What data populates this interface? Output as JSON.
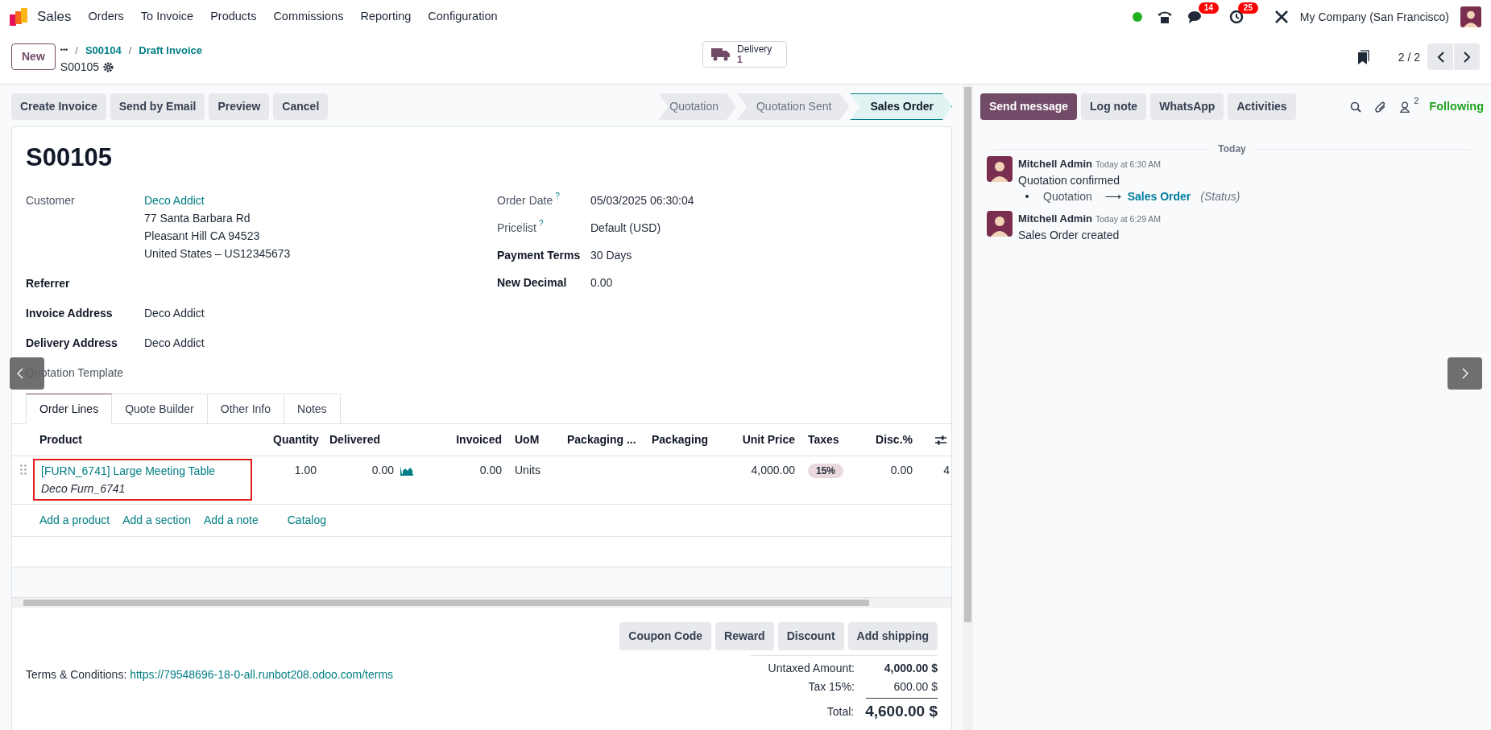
{
  "navbar": {
    "app": "Sales",
    "menu": [
      "Orders",
      "To Invoice",
      "Products",
      "Commissions",
      "Reporting",
      "Configuration"
    ],
    "chat_badge": "14",
    "activity_badge": "25",
    "company": "My Company (San Francisco)"
  },
  "control_panel": {
    "new_button": "New",
    "breadcrumbs_more": "•••",
    "breadcrumb_separator": "/",
    "breadcrumbs": [
      "S00104",
      "Draft Invoice"
    ],
    "record": "S00105",
    "smart_button": {
      "label": "Delivery",
      "count": "1"
    },
    "pager": "2 / 2"
  },
  "actions": [
    "Create Invoice",
    "Send by Email",
    "Preview",
    "Cancel"
  ],
  "statusbar": [
    {
      "label": "Quotation",
      "selected": false
    },
    {
      "label": "Quotation Sent",
      "selected": false
    },
    {
      "label": "Sales Order",
      "selected": true
    }
  ],
  "form": {
    "title": "S00105",
    "left_fields": [
      {
        "label": "Customer",
        "emphasized": false,
        "value": "Deco Addict",
        "kind": "link",
        "address": [
          "77 Santa Barbara Rd",
          "Pleasant Hill CA 94523",
          "United States – US12345673"
        ]
      },
      {
        "label": "Referrer",
        "emphasized": true
      },
      {
        "label": "Invoice Address",
        "emphasized": true,
        "value": "Deco Addict",
        "kind": "text"
      },
      {
        "label": "Delivery Address",
        "emphasized": true,
        "value": "Deco Addict",
        "kind": "text"
      },
      {
        "label": "Quotation Template",
        "emphasized": false
      }
    ],
    "right_fields": [
      {
        "label": "Order Date",
        "emphasized": false,
        "help": "?",
        "value": "05/03/2025 06:30:04"
      },
      {
        "label": "Pricelist",
        "emphasized": false,
        "help": "?",
        "value": "Default (USD)"
      },
      {
        "label": "Payment Terms",
        "emphasized": true,
        "value": "30 Days"
      },
      {
        "label": "New Decimal",
        "emphasized": true,
        "value": "0.00"
      }
    ]
  },
  "tabs": [
    {
      "label": "Order Lines",
      "selected": true
    },
    {
      "label": "Quote Builder",
      "selected": false
    },
    {
      "label": "Other Info",
      "selected": false
    },
    {
      "label": "Notes",
      "selected": false
    }
  ],
  "table": {
    "columns": [
      "Product",
      "Quantity",
      "Delivered",
      "Invoiced",
      "UoM",
      "Packaging ...",
      "Packaging",
      "Unit Price",
      "Taxes",
      "Disc.%"
    ],
    "rows": [
      {
        "product": "[FURN_6741] Large Meeting Table",
        "description": "Deco Furn_6741",
        "highlighted": true,
        "quantity": "1.00",
        "delivered": "0.00",
        "invoiced": "0.00",
        "uom": "Units",
        "unit_price": "4,000.00",
        "taxes": "15%",
        "discount": "0.00",
        "column_12": "4"
      }
    ],
    "add_links": [
      "Add a product",
      "Add a section",
      "Add a note",
      "Catalog"
    ]
  },
  "footer_buttons": [
    "Coupon Code",
    "Reward",
    "Discount",
    "Add shipping"
  ],
  "terms": {
    "label": "Terms & Conditions:",
    "link": "https://79548696-18-0-all.runbot208.odoo.com/terms"
  },
  "totals": [
    {
      "label": "Untaxed Amount:",
      "value": "4,000.00 $",
      "kind": "subtotal"
    },
    {
      "label": "Tax 15%:",
      "value": "600.00 $",
      "kind": "tax"
    },
    {
      "label": "Total:",
      "value": "4,600.00 $",
      "kind": "total"
    }
  ],
  "chatter": {
    "buttons": [
      {
        "label": "Send message",
        "selected": true
      },
      {
        "label": "Log note",
        "selected": false
      },
      {
        "label": "WhatsApp",
        "selected": false
      },
      {
        "label": "Activities",
        "selected": false
      }
    ],
    "followers_count": "2",
    "follow": "Following",
    "date_separator": "Today",
    "messages": [
      {
        "author": "Mitchell Admin",
        "time": "Today at 6:30 AM",
        "body": "Quotation confirmed",
        "tracking": {
          "old": "Quotation",
          "arrow": "⟶",
          "new": "Sales Order",
          "field": "(Status)"
        }
      },
      {
        "author": "Mitchell Admin",
        "time": "Today at 6:29 AM",
        "body": "Sales Order created"
      }
    ]
  }
}
